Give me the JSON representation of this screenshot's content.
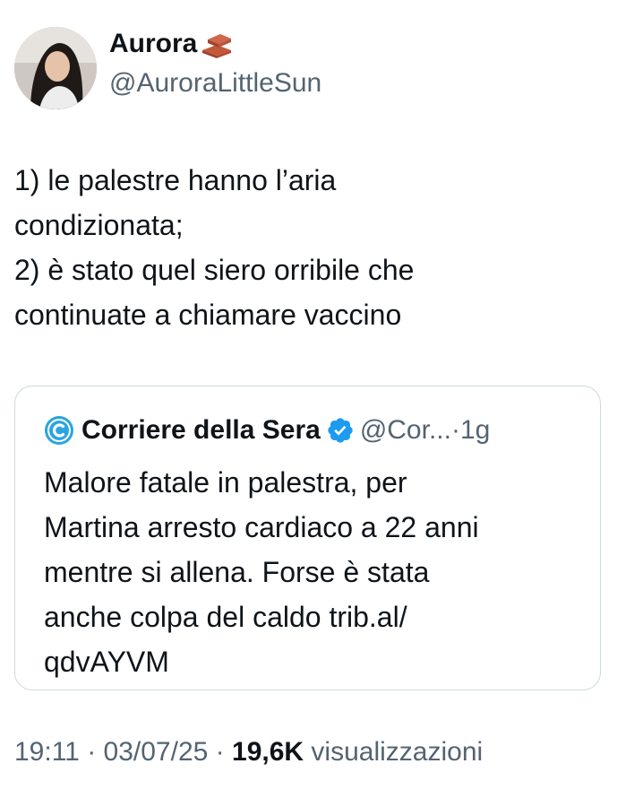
{
  "author": {
    "display_name": "Aurora",
    "name_emoji": "brick-icon",
    "handle": "@AuroraLittleSun"
  },
  "tweet": {
    "lines": [
      "1) le palestre hanno l’aria",
      "condizionata;",
      "2) è stato quel siero orribile che",
      "continuate a chiamare vaccino"
    ]
  },
  "quoted": {
    "logo_icon": "corriere-logo-icon",
    "display_name": "Corriere della Sera",
    "verified_icon": "verified-badge-icon",
    "handle": "@Cor...",
    "separator": "·",
    "time": "1g",
    "lines": [
      "Malore fatale in palestra, per",
      "Martina arresto cardiaco a 22 anni",
      "mentre si allena. Forse è stata",
      "anche colpa del caldo trib.al/",
      "qdvAYVM"
    ]
  },
  "meta": {
    "time": "19:11",
    "sep1": "·",
    "date": "03/07/25",
    "sep2": "·",
    "views_count": "19,6K",
    "views_label": "visualizzazioni"
  },
  "colors": {
    "text": "#0f1419",
    "secondary": "#536471",
    "verified": "#1d9bf0",
    "border": "#cfd9de"
  }
}
